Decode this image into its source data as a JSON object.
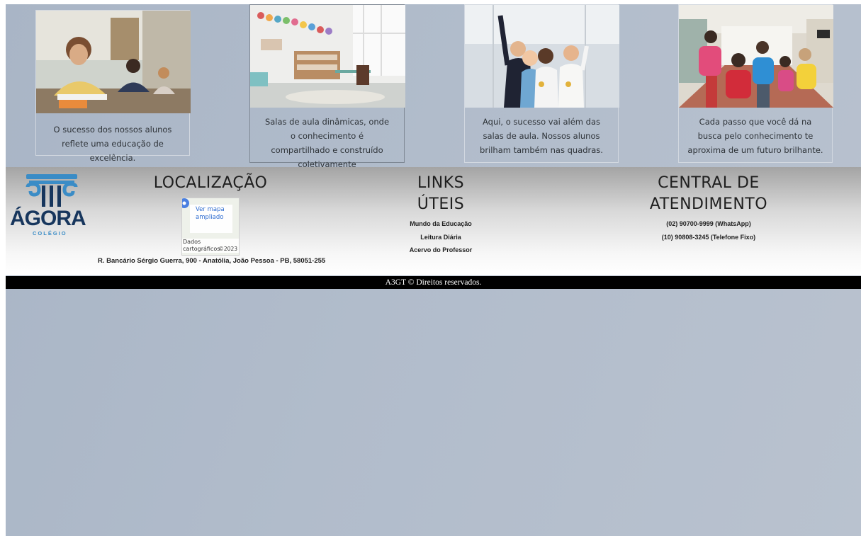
{
  "cards": [
    {
      "caption": "O sucesso dos nossos alunos reflete uma educação de excelência.",
      "image": "student-writing-photo"
    },
    {
      "caption": "Salas de aula dinâmicas, onde o conhecimento é compartilhado e construído coletivamente",
      "image": "classroom-photo"
    },
    {
      "caption": "Aqui, o sucesso vai além das salas de aula. Nossos alunos brilham também nas quadras.",
      "image": "kids-medals-photo"
    },
    {
      "caption": "Cada passo que você dá na busca pelo conhecimento te aproxima de um futuro brilhante.",
      "image": "kids-hallway-photo"
    }
  ],
  "footer": {
    "logo": {
      "name": "ÁGORA",
      "subtitle": "COLÉGIO"
    },
    "location": {
      "title": "LOCALIZAÇÃO",
      "map_link": "Ver mapa ampliado",
      "map_credit": "Dados cartográficos",
      "map_year": "©2023",
      "address": "R. Bancário Sérgio Guerra, 900 - Anatólia, João Pessoa - PB, 58051-255"
    },
    "links": {
      "title_line1": "LINKS",
      "title_line2": "ÚTEIS",
      "items": [
        "Mundo da Educação",
        "Leitura Diária",
        "Acervo do Professor"
      ]
    },
    "support": {
      "title_line1": "CENTRAL DE",
      "title_line2": "ATENDIMENTO",
      "phones": [
        "(02) 90700-9999 (WhatsApp)",
        "(10) 90808-3245 (Telefone Fixo)"
      ]
    },
    "copyright": "A3GT © Direitos reservados."
  },
  "colors": {
    "logo_dark": "#17365d",
    "logo_light": "#3a8cc6",
    "background": "#b1bccb"
  }
}
